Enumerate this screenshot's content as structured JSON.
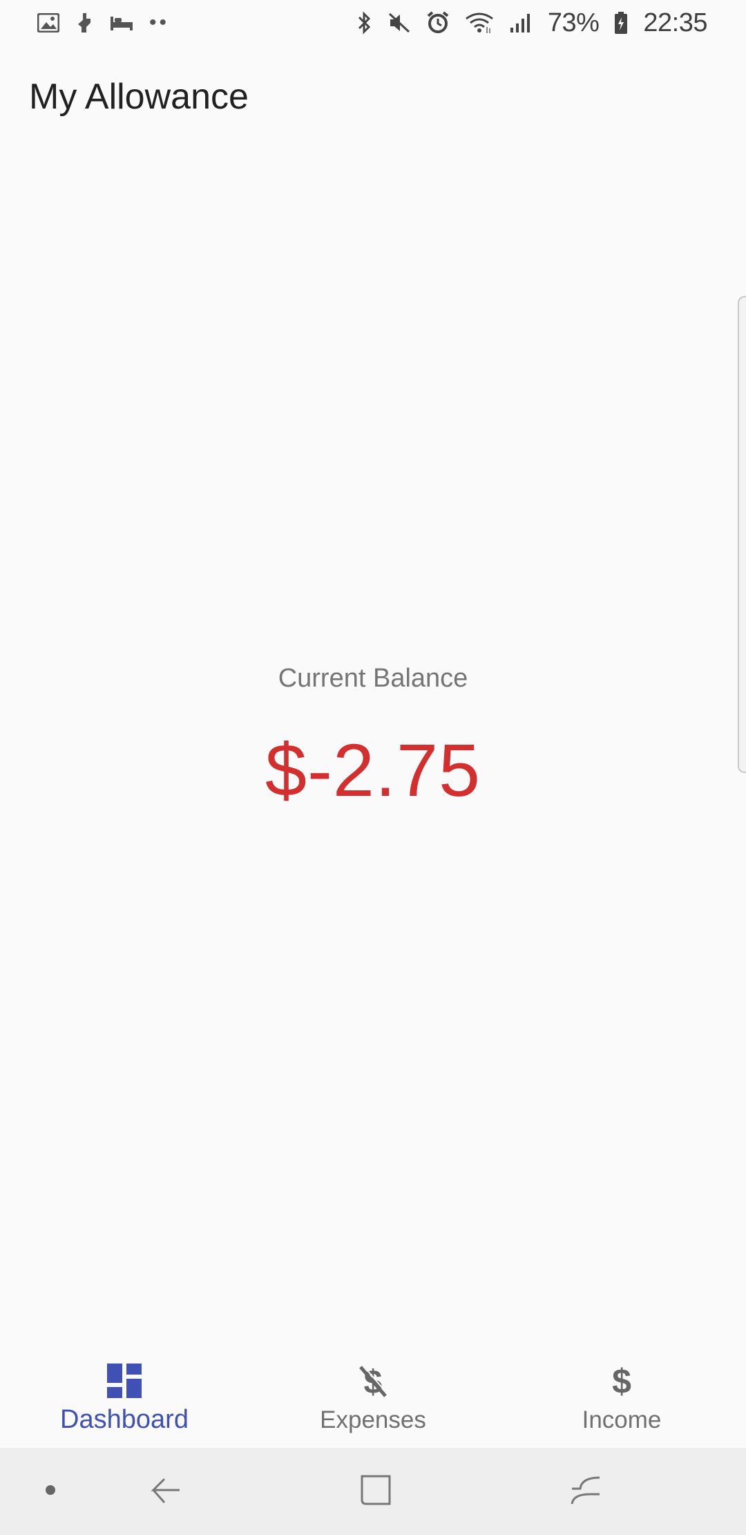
{
  "status_bar": {
    "battery_percent": "73%",
    "time": "22:35",
    "left_icons": [
      "gallery-icon",
      "tools-icon",
      "bed-icon",
      "more-dots-icon"
    ],
    "right_icons": [
      "bluetooth-icon",
      "mute-icon",
      "alarm-icon",
      "wifi-icon",
      "signal-icon",
      "battery-icon"
    ]
  },
  "app_bar": {
    "title": "My Allowance"
  },
  "balance": {
    "label": "Current Balance",
    "value": "$-2.75",
    "value_color": "#d32f2f"
  },
  "bottom_nav": {
    "items": [
      {
        "label": "Dashboard",
        "icon": "dashboard-icon",
        "active": true
      },
      {
        "label": "Expenses",
        "icon": "money-off-icon",
        "active": false
      },
      {
        "label": "Income",
        "icon": "dollar-icon",
        "active": false
      }
    ],
    "active_color": "#3f51b5"
  },
  "system_nav": {
    "icons": [
      "dot-icon",
      "back-icon",
      "home-icon",
      "recents-icon"
    ]
  }
}
